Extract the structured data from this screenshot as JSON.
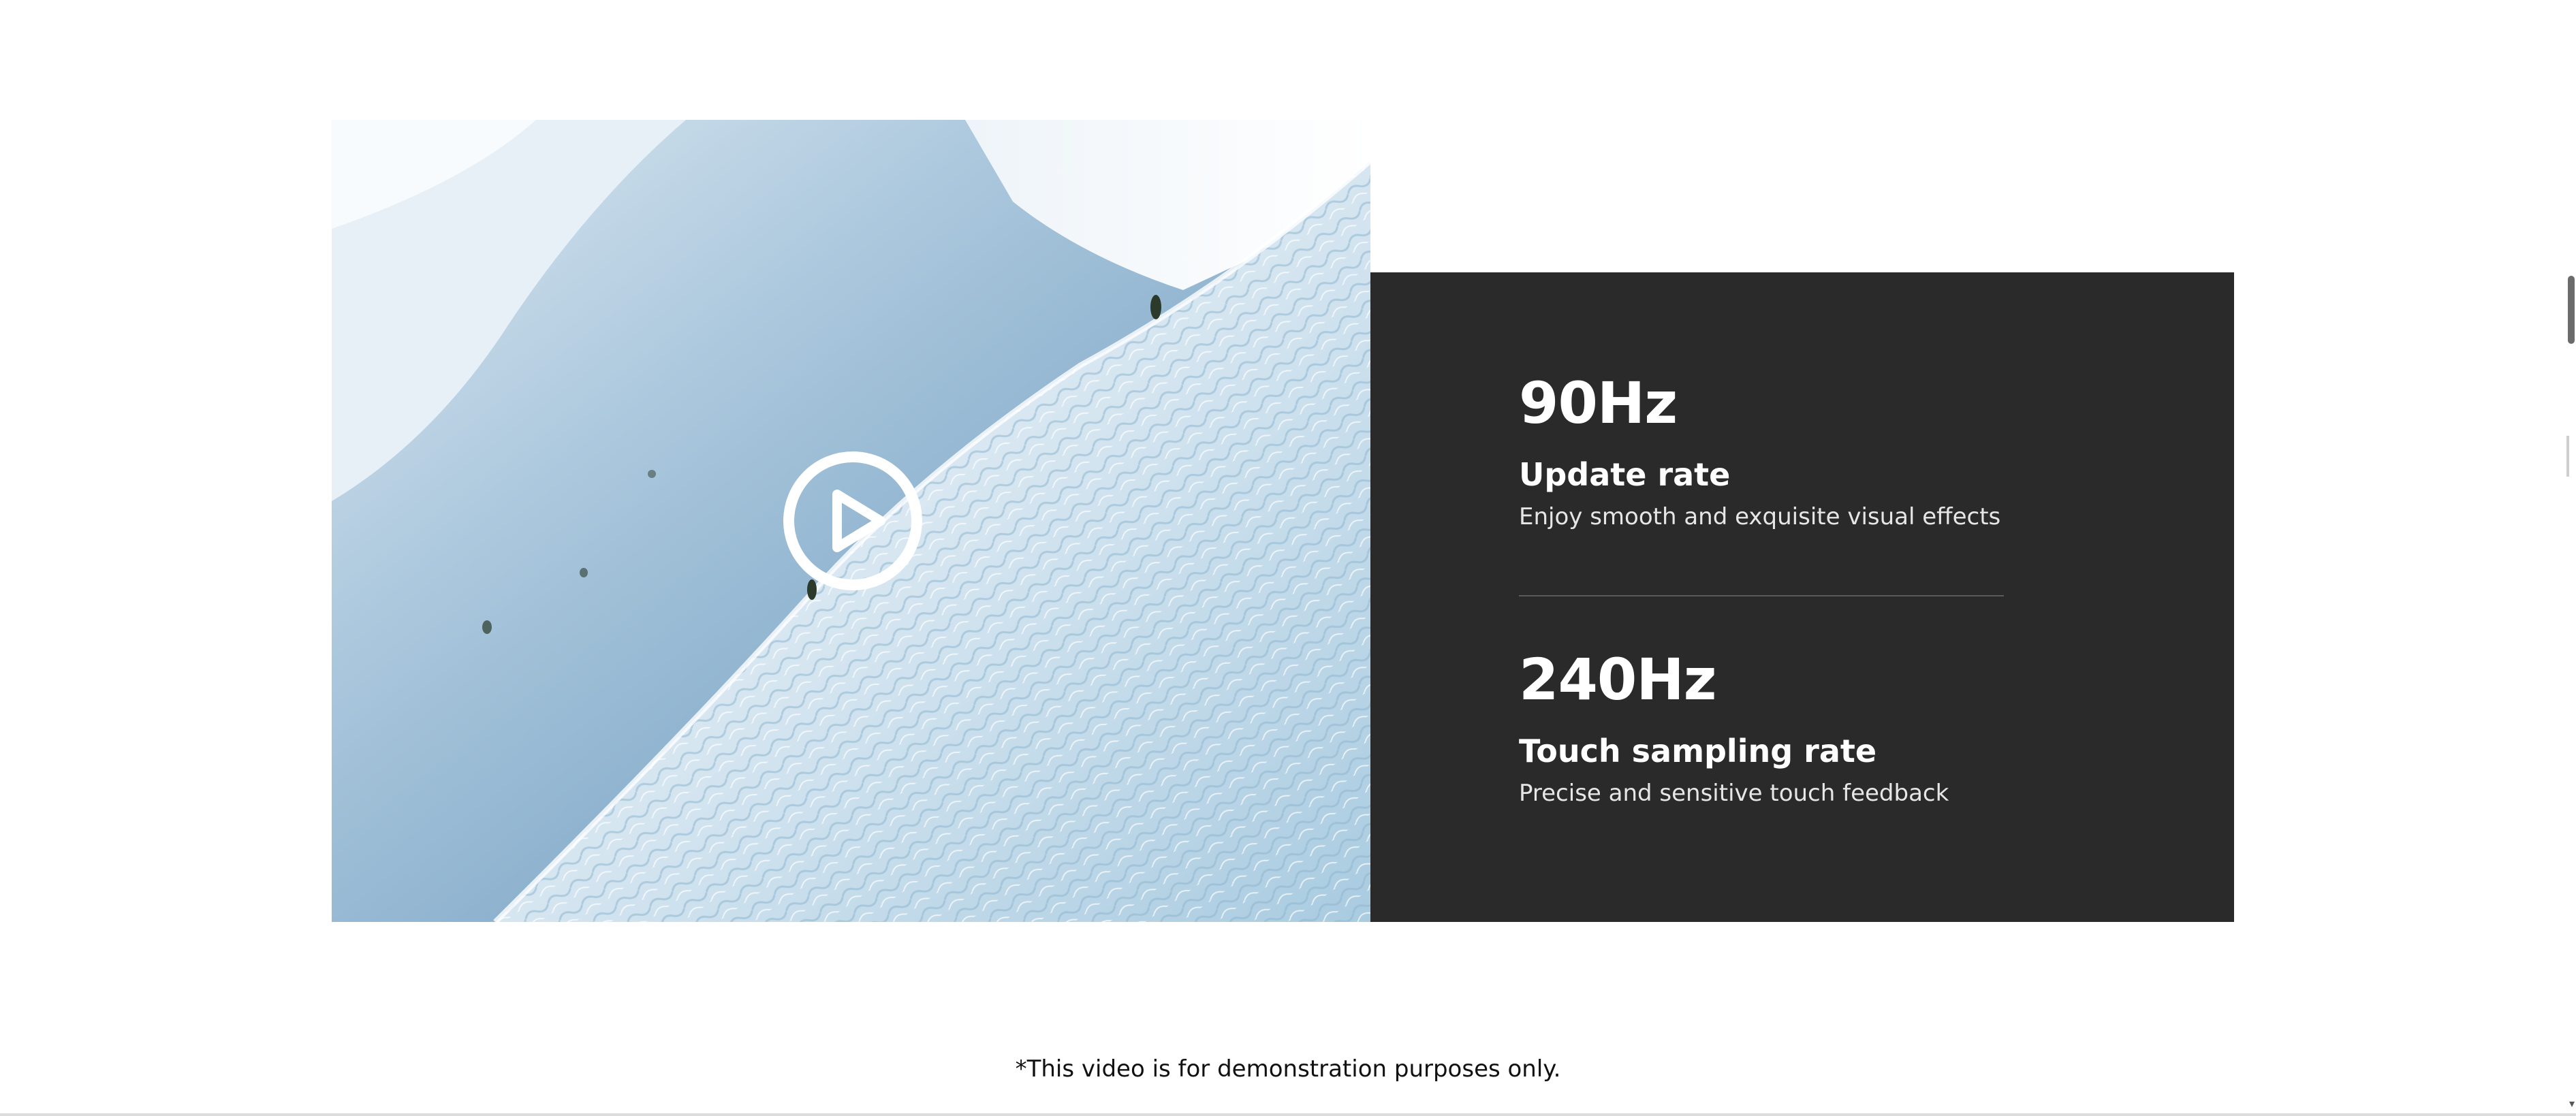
{
  "video": {
    "play_label": "Play video"
  },
  "specs": [
    {
      "value": "90Hz",
      "name": "Update rate",
      "description": "Enjoy smooth and exquisite visual effects"
    },
    {
      "value": "240Hz",
      "name": "Touch sampling rate",
      "description": "Precise and sensitive touch feedback"
    }
  ],
  "footnote": "*This video is for demonstration purposes only.",
  "colors": {
    "panel_background": "#2a2a2b",
    "page_background": "#ffffff",
    "text_light": "#ffffff"
  },
  "icons": {
    "play": "play-icon"
  }
}
